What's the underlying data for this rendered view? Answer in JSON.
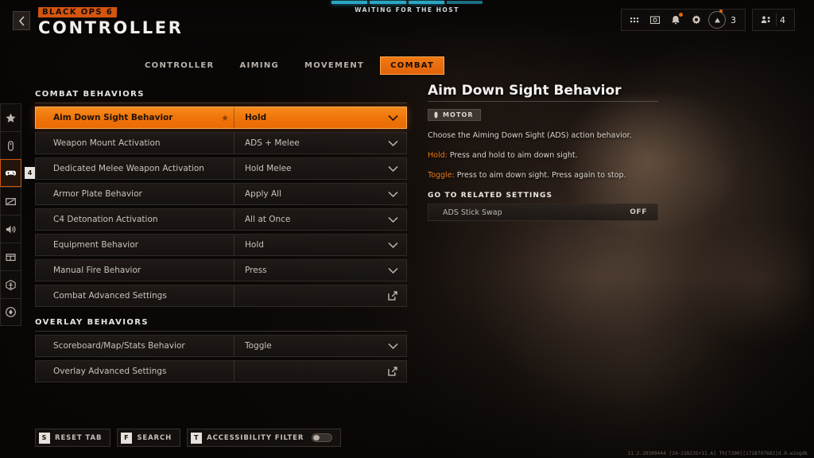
{
  "header": {
    "back_icon": "chevron-left-icon",
    "game_logo": "BLACK OPS 6",
    "screen_title": "CONTROLLER",
    "host_status": "WAITING FOR THE HOST",
    "host_segments": 4
  },
  "top_right": {
    "icons": [
      {
        "name": "apps-grid-icon",
        "glyph": "grid"
      },
      {
        "name": "screenshot-icon",
        "glyph": "camera"
      },
      {
        "name": "notifications-bell-icon",
        "glyph": "bell",
        "has_dot": true
      },
      {
        "name": "settings-gear-icon",
        "glyph": "gear"
      }
    ],
    "player_icon": "player-avatar-icon",
    "player_count": "3",
    "party_icon": "party-members-icon",
    "party_count": "4"
  },
  "tabs": [
    {
      "label": "CONTROLLER",
      "active": false
    },
    {
      "label": "AIMING",
      "active": false
    },
    {
      "label": "MOVEMENT",
      "active": false
    },
    {
      "label": "COMBAT",
      "active": true
    }
  ],
  "rail": [
    {
      "name": "sidebar-item-favorites",
      "icon": "star-icon",
      "active": false
    },
    {
      "name": "sidebar-item-mouse-keyboard",
      "icon": "mouse-icon",
      "active": false
    },
    {
      "name": "sidebar-item-controller",
      "icon": "gamepad-icon",
      "active": true,
      "badge": "4"
    },
    {
      "name": "sidebar-item-graphics",
      "icon": "display-icon",
      "active": false
    },
    {
      "name": "sidebar-item-audio",
      "icon": "speaker-icon",
      "active": false
    },
    {
      "name": "sidebar-item-interface",
      "icon": "interface-icon",
      "active": false
    },
    {
      "name": "sidebar-item-accessibility",
      "icon": "accessibility-icon",
      "active": false
    },
    {
      "name": "sidebar-item-account",
      "icon": "account-icon",
      "active": false
    }
  ],
  "sections": [
    {
      "title": "COMBAT BEHAVIORS",
      "rows": [
        {
          "label": "Aim Down Sight Behavior",
          "value": "Hold",
          "control": "dropdown",
          "selected": true,
          "favorite": true
        },
        {
          "label": "Weapon Mount Activation",
          "value": "ADS + Melee",
          "control": "dropdown",
          "selected": false,
          "favorite": false
        },
        {
          "label": "Dedicated Melee Weapon Activation",
          "value": "Hold Melee",
          "control": "dropdown",
          "selected": false,
          "favorite": false
        },
        {
          "label": "Armor Plate Behavior",
          "value": "Apply All",
          "control": "dropdown",
          "selected": false,
          "favorite": false
        },
        {
          "label": "C4 Detonation Activation",
          "value": "All at Once",
          "control": "dropdown",
          "selected": false,
          "favorite": false
        },
        {
          "label": "Equipment Behavior",
          "value": "Hold",
          "control": "dropdown",
          "selected": false,
          "favorite": false
        },
        {
          "label": "Manual Fire Behavior",
          "value": "Press",
          "control": "dropdown",
          "selected": false,
          "favorite": false
        },
        {
          "label": "Combat Advanced Settings",
          "value": "",
          "control": "external",
          "selected": false,
          "favorite": false
        }
      ]
    },
    {
      "title": "OVERLAY BEHAVIORS",
      "rows": [
        {
          "label": "Scoreboard/Map/Stats Behavior",
          "value": "Toggle",
          "control": "dropdown",
          "selected": false,
          "favorite": false
        },
        {
          "label": "Overlay Advanced Settings",
          "value": "",
          "control": "external",
          "selected": false,
          "favorite": false
        }
      ]
    }
  ],
  "info": {
    "title": "Aim Down Sight Behavior",
    "badge_icon": "motor-accessibility-icon",
    "badge_label": "MOTOR",
    "description": "Choose the Aiming Down Sight (ADS) action behavior.",
    "options": [
      {
        "name": "Hold:",
        "text": " Press and hold to aim down sight."
      },
      {
        "name": "Toggle:",
        "text": " Press to aim down sight. Press again to stop."
      }
    ],
    "related_header": "GO TO RELATED SETTINGS",
    "related": [
      {
        "label": "ADS Stick Swap",
        "value": "OFF"
      }
    ]
  },
  "bottom": {
    "buttons": [
      {
        "key": "S",
        "label": "RESET TAB",
        "toggle": false
      },
      {
        "key": "F",
        "label": "SEARCH",
        "toggle": false
      },
      {
        "key": "T",
        "label": "ACCESSIBILITY FILTER",
        "toggle": true
      }
    ],
    "build": "11.2.20309444 [24-218235+11.A] Th[7300][1728797682]d.0.wingdk"
  },
  "colors": {
    "accent": "#ef7408",
    "accent_light": "#f58a1d",
    "host_bar": "#2aa6c4",
    "text_primary": "#e8e3de",
    "text_secondary": "#c9c2bb"
  }
}
